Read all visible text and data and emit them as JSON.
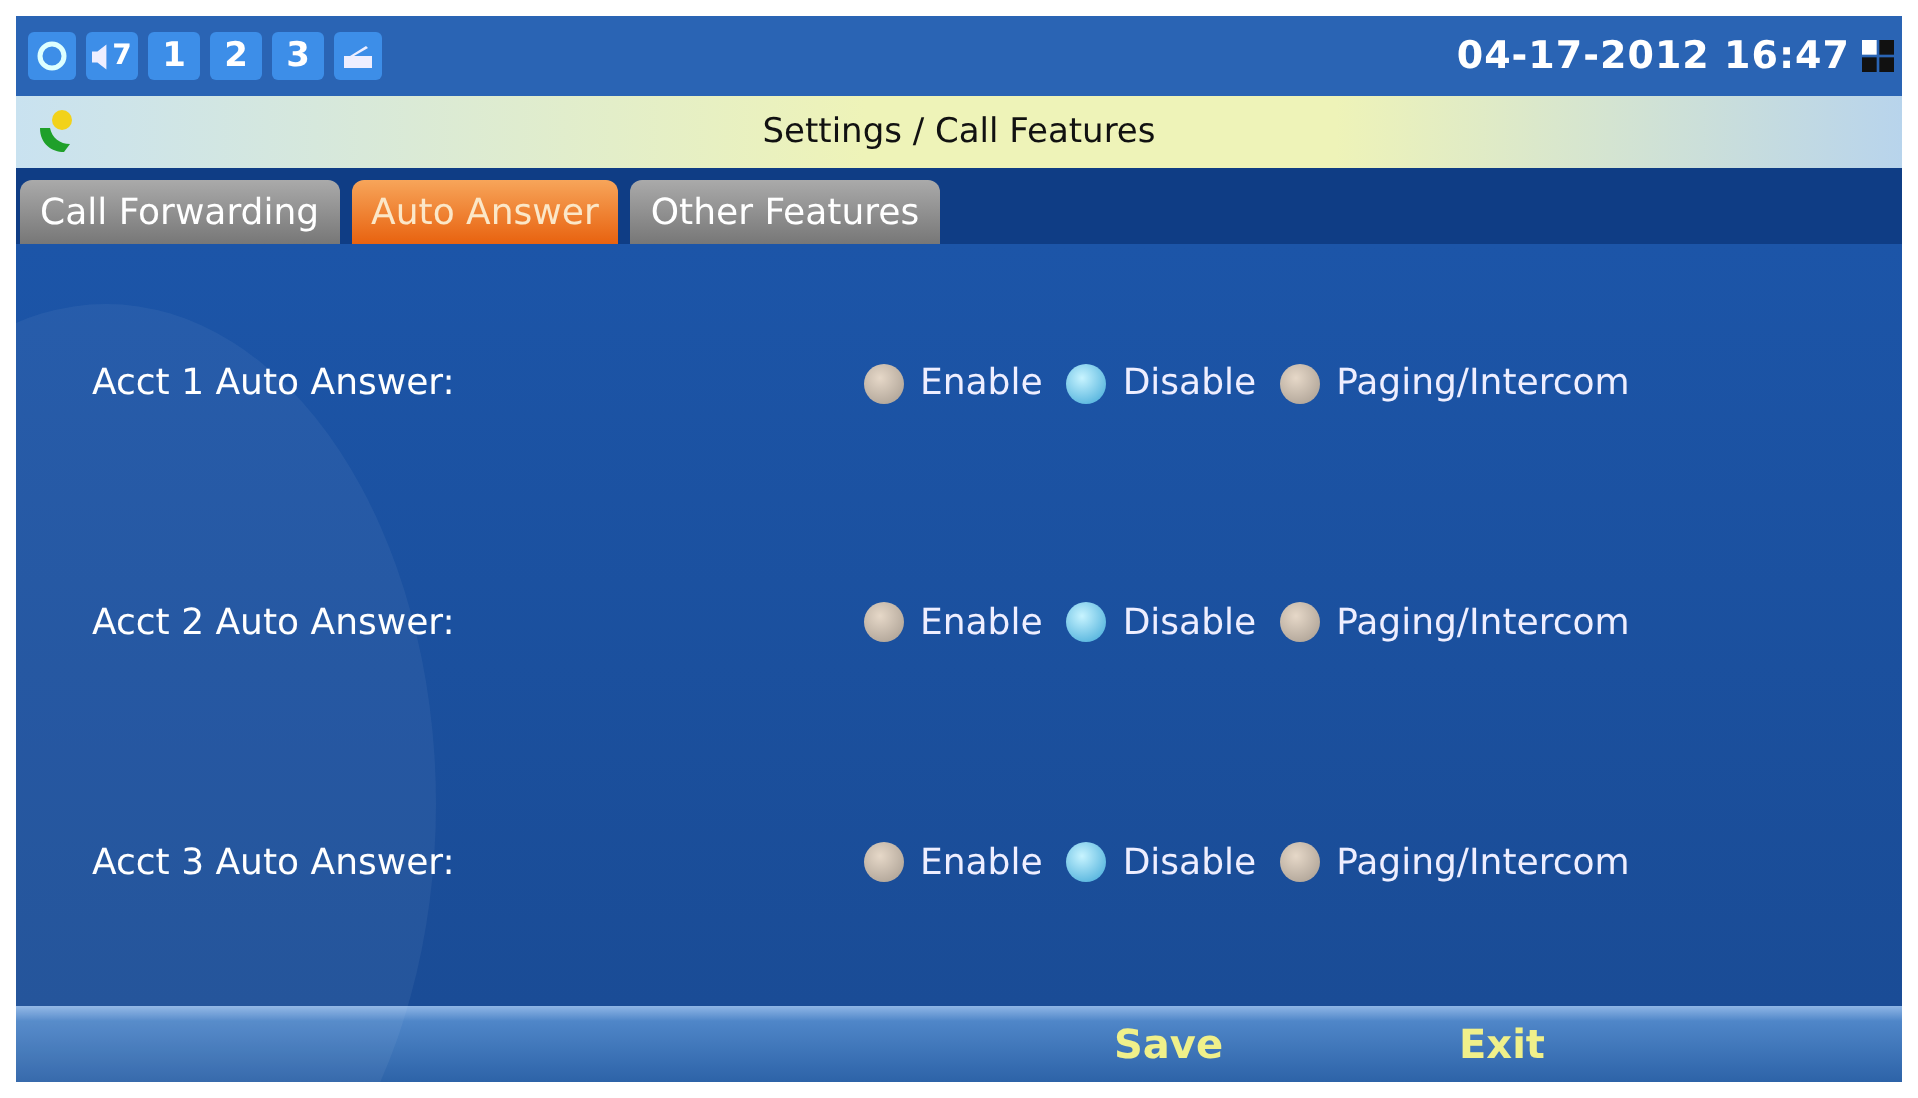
{
  "status_bar": {
    "volume": "7",
    "accounts": [
      "1",
      "2",
      "3"
    ],
    "datetime": "04-17-2012 16:47"
  },
  "title_bar": {
    "title": "Settings / Call Features"
  },
  "tabs": [
    {
      "label": "Call Forwarding",
      "selected": false
    },
    {
      "label": "Auto Answer",
      "selected": true
    },
    {
      "label": "Other Features",
      "selected": false
    }
  ],
  "rows": [
    {
      "label": "Acct 1 Auto Answer:",
      "options": [
        {
          "label": "Enable",
          "selected": false
        },
        {
          "label": "Disable",
          "selected": true
        },
        {
          "label": "Paging/Intercom",
          "selected": false
        }
      ]
    },
    {
      "label": "Acct 2 Auto Answer:",
      "options": [
        {
          "label": "Enable",
          "selected": false
        },
        {
          "label": "Disable",
          "selected": true
        },
        {
          "label": "Paging/Intercom",
          "selected": false
        }
      ]
    },
    {
      "label": "Acct 3 Auto Answer:",
      "options": [
        {
          "label": "Enable",
          "selected": false
        },
        {
          "label": "Disable",
          "selected": true
        },
        {
          "label": "Paging/Intercom",
          "selected": false
        }
      ]
    }
  ],
  "softkeys": [
    "Save",
    "Exit"
  ]
}
